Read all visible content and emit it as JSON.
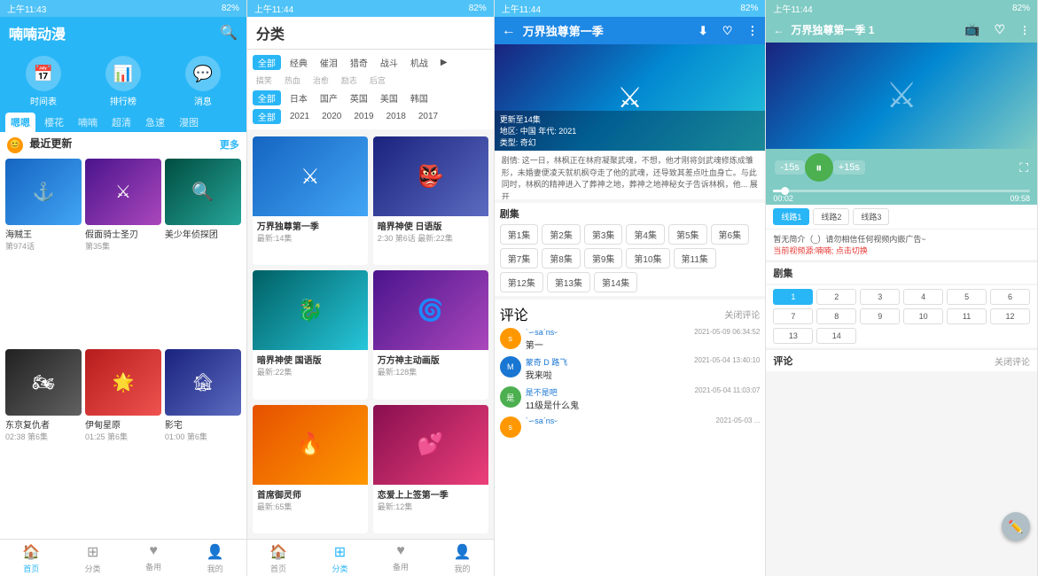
{
  "panels": {
    "p1": {
      "status": "上午11:43",
      "battery": "82%",
      "header_title": "喃喃动漫",
      "icons": [
        {
          "label": "时间表",
          "emoji": "📅"
        },
        {
          "label": "排行榜",
          "emoji": "📊"
        },
        {
          "label": "消息",
          "emoji": "💬"
        }
      ],
      "tabs": [
        "嗯嗯",
        "樱花",
        "喃喃",
        "超清",
        "急速",
        "漫图"
      ],
      "active_tab": 0,
      "section_title": "最近更新",
      "more": "更多",
      "animes": [
        {
          "title": "海贼王",
          "sub": "第974话",
          "color": "bg-blue",
          "emoji": "⚓"
        },
        {
          "title": "假面骑士圣刃",
          "sub": "第35集",
          "color": "bg-purple",
          "emoji": "⚔"
        },
        {
          "title": "美少年侦探团",
          "sub": "",
          "color": "bg-teal",
          "emoji": "🔍"
        },
        {
          "title": "东京复仇者",
          "sub": "02:38 第6集",
          "color": "bg-dark",
          "emoji": "🏍"
        },
        {
          "title": "伊甸星原",
          "sub": "01:25 第6集",
          "color": "bg-red",
          "emoji": "🌟"
        },
        {
          "title": "影宅",
          "sub": "01:00 第6集",
          "color": "bg-indigo",
          "emoji": "🏚"
        }
      ],
      "nav": [
        {
          "label": "首页",
          "icon": "🏠",
          "active": true
        },
        {
          "label": "分类",
          "icon": "⊞"
        },
        {
          "label": "备用",
          "icon": "♥"
        },
        {
          "label": "我的",
          "icon": "👤"
        }
      ]
    },
    "p2": {
      "status": "上午11:44",
      "battery": "82%",
      "header_title": "分类",
      "filter_groups": [
        {
          "active": "全部",
          "tags": [
            "全部",
            "经典",
            "催泪",
            "猎奇",
            "战斗",
            "机战",
            "搞笑",
            "热血",
            "治愈",
            "励志",
            "后宫"
          ]
        },
        {
          "active": "全部",
          "tags": [
            "全部",
            "日本",
            "国产",
            "英国",
            "美国",
            "韩国"
          ]
        },
        {
          "active": "全部",
          "tags": [
            "全部",
            "2021",
            "2020",
            "2019",
            "2018",
            "2017"
          ]
        }
      ],
      "animes": [
        {
          "title": "万界独尊第一季",
          "latest": "最新:14集",
          "color": "bg-blue",
          "emoji": "⚔"
        },
        {
          "title": "暗界神使 日语版",
          "latest": "2:30 第6话 最新:22集",
          "color": "bg-indigo",
          "emoji": "👺"
        },
        {
          "title": "暗界神使 国语版",
          "latest": "最新:22集",
          "color": "bg-cyan",
          "emoji": "🐉"
        },
        {
          "title": "万方神主动画版",
          "latest": "最新:128集",
          "color": "bg-purple",
          "emoji": "🌀"
        },
        {
          "title": "首席御灵师",
          "latest": "最新:65集",
          "color": "bg-orange",
          "emoji": "🔥"
        },
        {
          "title": "恋爱上上签第一季",
          "latest": "最新:12集",
          "color": "bg-pink",
          "emoji": "💕"
        }
      ],
      "nav": [
        {
          "label": "首页",
          "icon": "🏠"
        },
        {
          "label": "分类",
          "icon": "⊞",
          "active": true
        },
        {
          "label": "备用",
          "icon": "♥"
        },
        {
          "label": "我的",
          "icon": "👤"
        }
      ]
    },
    "p3": {
      "status": "上午11:44",
      "battery": "82%",
      "header_title": "万界独尊第一季",
      "meta": {
        "update": "更新至14集",
        "region": "地区: 中国 年代: 2021",
        "type": "类型: 奇幻"
      },
      "desc": "剧情: 这一日，林枫正在林府凝聚武魂，不想，他才刚将剑武魂修炼成雏形，未婚妻便凌天就机枫夺走了他的武魂，还导致其差点吐血身亡。与此同时，林枫的精神进入了葬神之地，葬神之地神秘女子告诉林枫，他... 展开",
      "episodes_title": "剧集",
      "episodes": [
        "第1集",
        "第2集",
        "第3集",
        "第4集",
        "第5集",
        "第6集",
        "第7集",
        "第8集",
        "第9集",
        "第10集",
        "第11集",
        "第12集",
        "第13集",
        "第14集"
      ],
      "comments_title": "评论",
      "close_comments": "关闭评论",
      "comments": [
        {
          "user": "ˋ∽saˊnsᵕ",
          "time": "2021-05-09 06:34:52",
          "text": "第一",
          "avatar_color": "#ff9800",
          "avatar_text": "s"
        },
        {
          "user": "蒙奇 D 路飞",
          "time": "2021-05-04 13:40:10",
          "text": "我来啦",
          "avatar_color": "#1976d2",
          "avatar_text": "M"
        },
        {
          "user": "是不是吧",
          "time": "2021-05-04 11:03:07",
          "text": "11级是什么鬼",
          "avatar_color": "#4caf50",
          "avatar_text": "是"
        },
        {
          "user": "ˋ∽saˊnsᵕ",
          "time": "2021-05-03 ...",
          "text": "",
          "avatar_color": "#ff9800",
          "avatar_text": "s"
        }
      ]
    },
    "p4": {
      "status": "上午11:44",
      "battery": "82%",
      "header_title": "万界独尊第一季 1",
      "time_current": "00:02",
      "time_total": "09:58",
      "rewind": "-15s",
      "forward": "+15s",
      "sources": [
        "线路1",
        "线路2",
        "线路3"
      ],
      "active_source": 0,
      "notice_title": "暂无简介（_）请勿相信任何视频内嵌广告~",
      "notice_link": "当前视频源:喃喃; 点击切换",
      "episodes_title": "剧集",
      "episodes": [
        "1",
        "2",
        "3",
        "4",
        "5",
        "6",
        "7",
        "8",
        "9",
        "10",
        "11",
        "12",
        "13",
        "14"
      ],
      "active_episode": 0,
      "comments_title": "评论",
      "close_comments": "关闭评论"
    }
  }
}
